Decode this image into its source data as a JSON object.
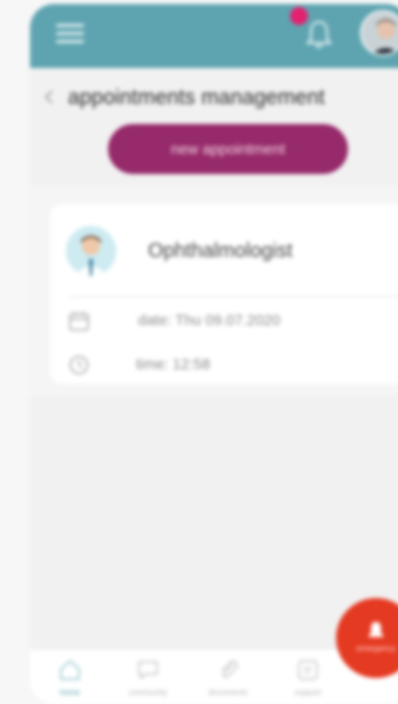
{
  "header": {
    "notification_count": "",
    "colors": {
      "bar": "#5ea4b0",
      "badge": "#e3216f"
    }
  },
  "page": {
    "title": "appointments management",
    "new_button_label": "new appointment"
  },
  "appointment": {
    "specialty": "Ophthalmologist",
    "date": "date: Thu 09.07.2020",
    "time": "time: 12:58"
  },
  "bottom_nav": {
    "items": [
      {
        "label": "home",
        "icon": "home-icon"
      },
      {
        "label": "community",
        "icon": "chat-icon"
      },
      {
        "label": "documents",
        "icon": "paperclip-icon"
      },
      {
        "label": "support",
        "icon": "support-icon"
      }
    ]
  },
  "fab": {
    "label": "emergency",
    "color": "#e53a22"
  }
}
